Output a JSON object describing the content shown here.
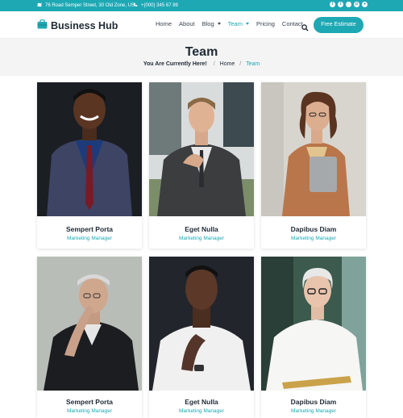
{
  "topbar": {
    "address": "76 Road Semper Street, 30 Old Zone, US",
    "phone": "+(000) 345 67 89",
    "socials": [
      "facebook-icon",
      "twitter-icon",
      "instagram-icon",
      "pinterest-icon",
      "dribbble-icon"
    ]
  },
  "header": {
    "brand": "Business Hub",
    "nav": [
      {
        "label": "Home"
      },
      {
        "label": "About"
      },
      {
        "label": "Blog"
      },
      {
        "label": "Team"
      },
      {
        "label": "Pricing"
      },
      {
        "label": "Contact"
      }
    ],
    "cta": "Free Estimate"
  },
  "page": {
    "title": "Team",
    "crumb_prefix": "You Are Currently Here!",
    "crumb_home": "Home",
    "crumb_current": "Team"
  },
  "team": [
    {
      "name": "Sempert Porta",
      "role": "Marketing Manager"
    },
    {
      "name": "Eget Nulla",
      "role": "Marketing Manager"
    },
    {
      "name": "Dapibus Diam",
      "role": "Marketing Manager"
    },
    {
      "name": "Sempert Porta",
      "role": "Marketing Manager"
    },
    {
      "name": "Eget Nulla",
      "role": "Marketing Manager"
    },
    {
      "name": "Dapibus Diam",
      "role": "Marketing Manager"
    }
  ],
  "colors": {
    "accent": "#1ea8b4",
    "dark": "#1f2a36",
    "band": "#f4f4f4"
  }
}
